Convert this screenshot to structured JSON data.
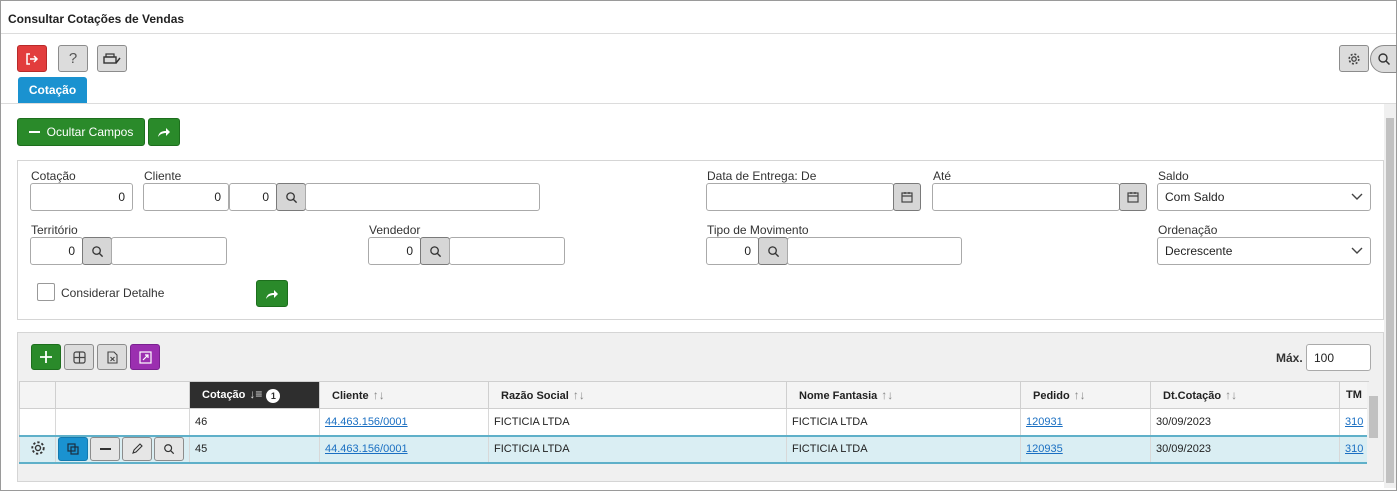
{
  "window": {
    "title": "Consultar Cotações de Vendas"
  },
  "toolbar": {
    "exit_icon": "exit-icon",
    "help_label": "?",
    "print_icon": "print-icon",
    "settings_icon": "gear-icon",
    "search_icon": "search-icon"
  },
  "tabs": [
    {
      "label": "Cotação",
      "active": true
    }
  ],
  "actions": {
    "hide_fields_label": "Ocultar Campos"
  },
  "filters": {
    "cotacao": {
      "label": "Cotação",
      "value": "0"
    },
    "cliente": {
      "label": "Cliente",
      "value1": "0",
      "value2": "0",
      "name": ""
    },
    "data_entrega_de": {
      "label": "Data de Entrega: De",
      "value": ""
    },
    "ate": {
      "label": "Até",
      "value": ""
    },
    "saldo": {
      "label": "Saldo",
      "selected": "Com Saldo"
    },
    "territorio": {
      "label": "Território",
      "value": "0",
      "name": ""
    },
    "vendedor": {
      "label": "Vendedor",
      "value": "0",
      "name": ""
    },
    "tipo_movimento": {
      "label": "Tipo de Movimento",
      "value": "0",
      "name": ""
    },
    "ordenacao": {
      "label": "Ordenação",
      "selected": "Decrescente"
    },
    "considerar_detalhe": {
      "label": "Considerar Detalhe",
      "checked": false
    }
  },
  "grid": {
    "max_label": "Máx.",
    "max_value": "100",
    "columns": [
      "Cotação",
      "Cliente",
      "Razão Social",
      "Nome Fantasia",
      "Pedido",
      "Dt.Cotação",
      "TM"
    ],
    "sort_badge": "1",
    "rows": [
      {
        "cotacao": "46",
        "cliente": "44.463.156/0001",
        "razao_social": "FICTICIA LTDA",
        "nome_fantasia": "FICTICIA LTDA",
        "pedido": "120931",
        "dt_cotacao": "30/09/2023",
        "tm": "310",
        "selected": false
      },
      {
        "cotacao": "45",
        "cliente": "44.463.156/0001",
        "razao_social": "FICTICIA LTDA",
        "nome_fantasia": "FICTICIA LTDA",
        "pedido": "120935",
        "dt_cotacao": "30/09/2023",
        "tm": "310",
        "selected": true
      }
    ]
  },
  "colors": {
    "accent": "#1a92d0",
    "green": "#2a8a2a",
    "danger": "#e03c3c",
    "purple": "#9b2fb0"
  }
}
